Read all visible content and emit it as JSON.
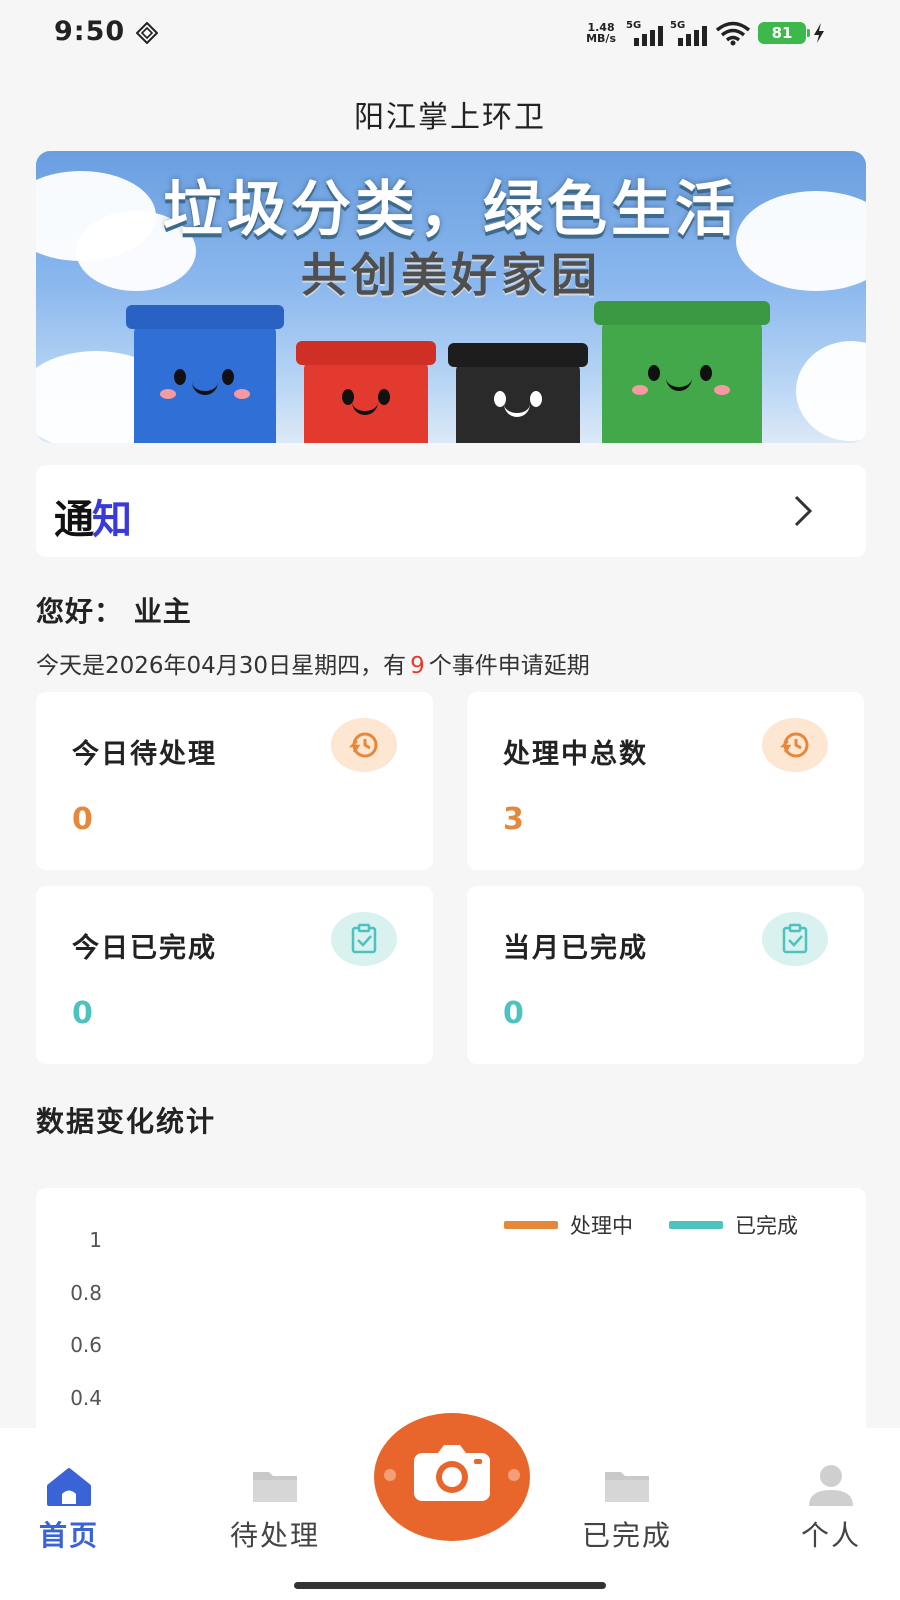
{
  "status_bar": {
    "time": "9:50",
    "net_speed_value": "1.48",
    "net_speed_unit": "MB/s",
    "signal_1_label": "5G",
    "signal_2_label": "5G",
    "battery": "81",
    "icons": [
      "nfc-diamond-icon",
      "signal-icon",
      "wifi-icon",
      "battery-icon",
      "charging-icon"
    ]
  },
  "header": {
    "title": "阳江掌上环卫"
  },
  "banner": {
    "title": "垃圾分类，绿色生活",
    "subtitle": "共创美好家园",
    "bin_colors": [
      "#2f6fd6",
      "#e23a2e",
      "#2a2a2a",
      "#43a84a"
    ]
  },
  "notice": {
    "logo_part1": "通",
    "logo_part2": "知",
    "icon": "chevron-right-icon"
  },
  "greeting": {
    "hello": "您好：  业主",
    "line_prefix": "今天是2026年04月30日星期四，有",
    "count": "9",
    "line_suffix": "个事件申请延期"
  },
  "stats": [
    {
      "label": "今日待处理",
      "value": "0",
      "icon": "history-icon",
      "color": "#e6883b"
    },
    {
      "label": "处理中总数",
      "value": "3",
      "icon": "history-icon",
      "color": "#e6883b"
    },
    {
      "label": "今日已完成",
      "value": "0",
      "icon": "clipboard-check-icon",
      "color": "#4dc2c0"
    },
    {
      "label": "当月已完成",
      "value": "0",
      "icon": "clipboard-check-icon",
      "color": "#4dc2c0"
    }
  ],
  "section": {
    "title": "数据变化统计"
  },
  "chart_data": {
    "type": "line",
    "series": [
      {
        "name": "处理中",
        "color": "#e6883b",
        "values": []
      },
      {
        "name": "已完成",
        "color": "#4dc2c0",
        "values": []
      }
    ],
    "y_ticks": [
      "1",
      "0.8",
      "0.6",
      "0.4"
    ],
    "legend_position": "top-right"
  },
  "nav": {
    "items": [
      {
        "label": "首页",
        "icon": "home-icon",
        "active": true
      },
      {
        "label": "待处理",
        "icon": "folder-icon",
        "active": false
      },
      {
        "label": "已完成",
        "icon": "folder-icon",
        "active": false
      },
      {
        "label": "个人",
        "icon": "user-icon",
        "active": false
      }
    ],
    "camera_icon": "camera-icon",
    "accent": "#3b63d8",
    "fab_color": "#e8662c"
  }
}
